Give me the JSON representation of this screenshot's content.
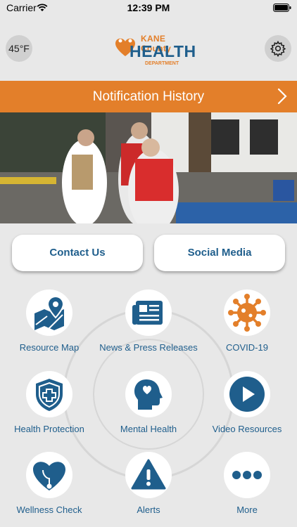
{
  "status_bar": {
    "carrier": "Carrier",
    "time": "12:39 PM"
  },
  "header": {
    "temperature": "45°F",
    "logo_line1": "KANE County",
    "logo_line2": "HEALTH",
    "logo_line3": "DEPARTMENT"
  },
  "notification": {
    "label": "Notification History"
  },
  "buttons": {
    "contact": "Contact Us",
    "social": "Social Media"
  },
  "tiles": [
    {
      "label": "Resource Map",
      "icon": "map-pin-icon"
    },
    {
      "label": "News & Press Releases",
      "icon": "newspaper-icon"
    },
    {
      "label": "COVID-19",
      "icon": "virus-icon"
    },
    {
      "label": "Health Protection",
      "icon": "shield-cross-icon"
    },
    {
      "label": "Mental Health",
      "icon": "head-heart-icon"
    },
    {
      "label": "Video Resources",
      "icon": "play-icon"
    },
    {
      "label": "Wellness Check",
      "icon": "heart-stethoscope-icon"
    },
    {
      "label": "Alerts",
      "icon": "warning-icon"
    },
    {
      "label": "More",
      "icon": "more-dots-icon"
    }
  ],
  "colors": {
    "accent_orange": "#e37f2a",
    "brand_blue": "#1f5e8c"
  }
}
